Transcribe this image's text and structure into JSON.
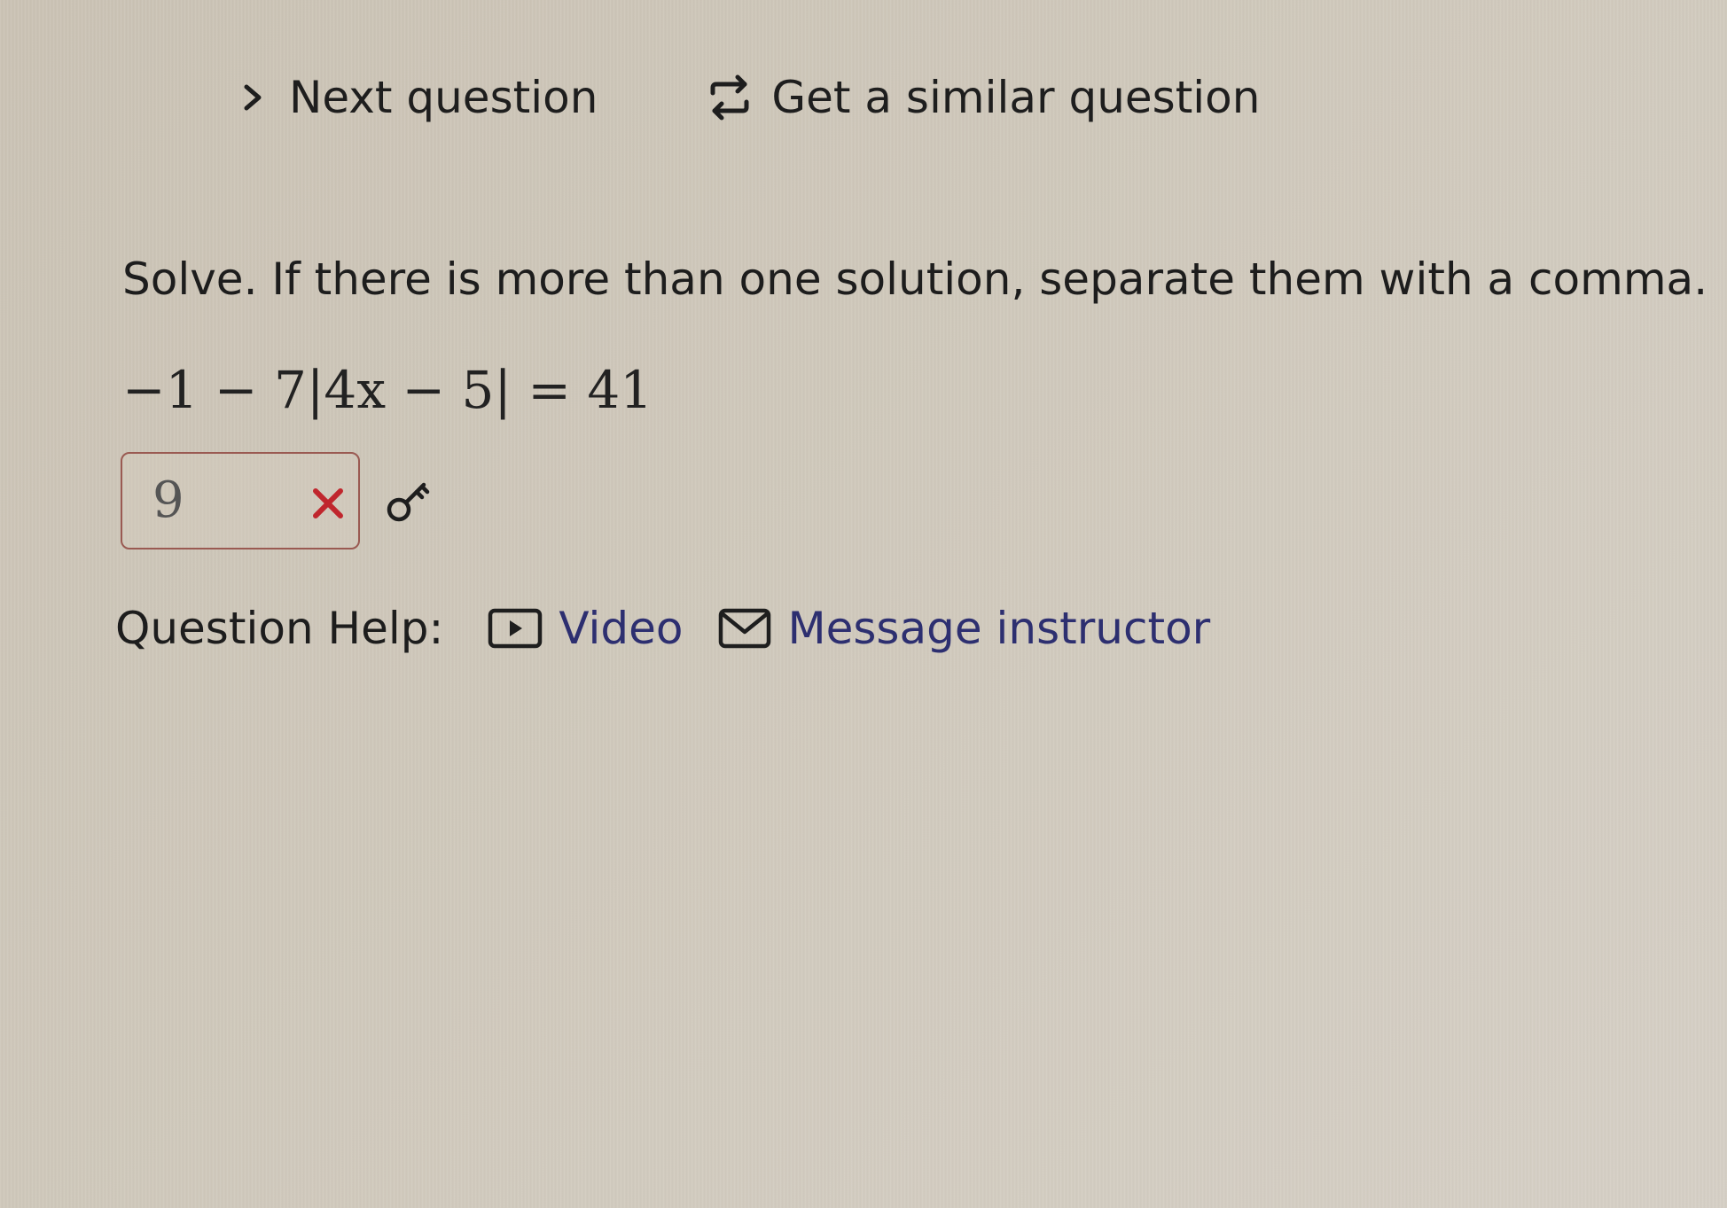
{
  "nav": {
    "next_label": "Next question",
    "similar_label": "Get a similar question"
  },
  "question": {
    "prompt": "Solve. If there is more than one solution, separate them with a comma.",
    "equation": "−1 − 7|4x − 5| = 41"
  },
  "answer": {
    "value": "9",
    "status_icon": "x-mark-icon",
    "status_color": "#c0262d"
  },
  "help": {
    "label": "Question Help:",
    "video_label": "Video",
    "message_label": "Message instructor"
  },
  "colors": {
    "link": "#2d2f70",
    "answer_border": "#9a5a52"
  }
}
